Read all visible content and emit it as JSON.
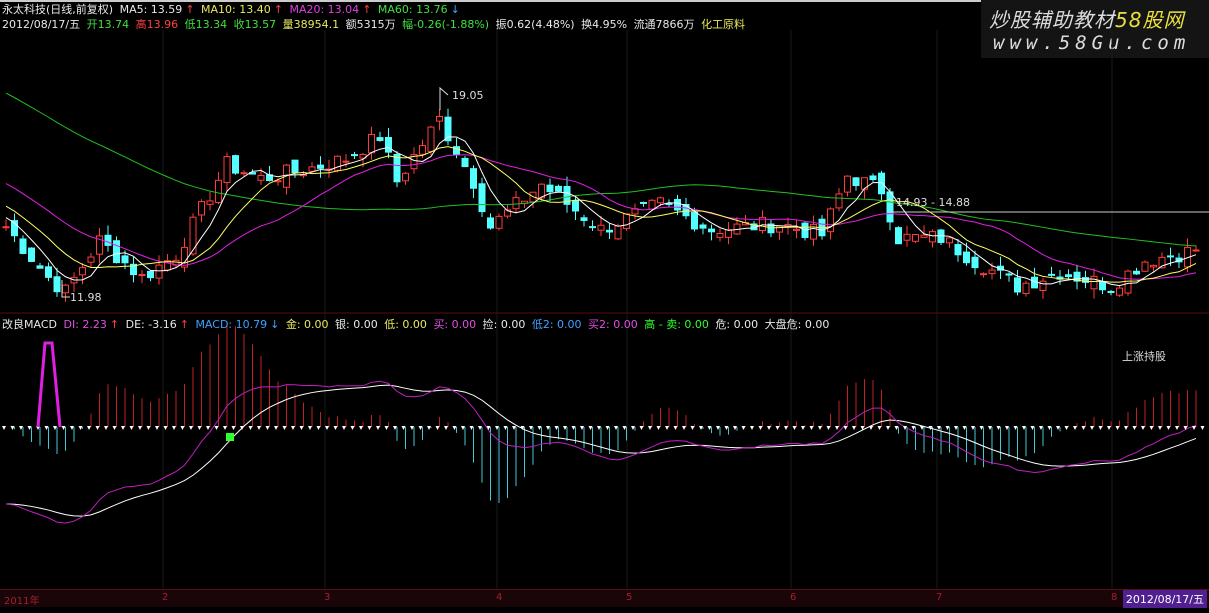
{
  "header": {
    "name": "永太科技(日线,前复权)",
    "ma5": "MA5: 13.59",
    "ma10": "MA10: 13.40",
    "ma20": "MA20: 13.04",
    "ma60": "MA60: 13.76",
    "date": "2012/08/17/五",
    "open": "开13.74",
    "high": "高13.96",
    "low": "低13.34",
    "close": "收13.57",
    "volume": "量38954.1",
    "amount": "额5315万",
    "change": "幅-0.26(-1.88%)",
    "amplitude": "振0.62(4.48%)",
    "turnover": "换4.95%",
    "float": "流通7866万",
    "sector": "化工原料"
  },
  "watermark": {
    "line1a": "炒股辅助教材",
    "line1b": "58股网",
    "line2": "www.58Gu.com"
  },
  "annotations": {
    "high_label": "19.05",
    "low_label": "11.98",
    "range_label": "14.93 - 14.88",
    "signal_label": "上涨持股"
  },
  "macd_header": {
    "title": "改良MACD",
    "di": "DI: 2.23",
    "de": "DE: -3.16",
    "macd": "MACD: 10.79",
    "jin": "金: 0.00",
    "yin": "银: 0.00",
    "di_low": "低: 0.00",
    "mai": "买: 0.00",
    "jian": "捡: 0.00",
    "di2": "低2: 0.00",
    "mai2": "买2: 0.00",
    "gao_mai": "高 - 卖: 0.00",
    "wei": "危: 0.00",
    "dapan": "大盘危: 0.00"
  },
  "axis": {
    "ticks": [
      "2011年",
      "2",
      "3",
      "4",
      "5",
      "6",
      "7",
      "8"
    ],
    "current_date": "2012/08/17/五"
  },
  "colors": {
    "up": "#ff3c3c",
    "down": "#54ffff",
    "ma5": "#ffffff",
    "ma10": "#ffff60",
    "ma20": "#e020e0",
    "ma60": "#20c020"
  },
  "chart_data": {
    "type": "candlestick",
    "title": "永太科技(日线,前复权)",
    "price_range": [
      11.98,
      19.05
    ],
    "close_path": [
      [
        0,
        14.4
      ],
      [
        5,
        12.6
      ],
      [
        7,
        12.1
      ],
      [
        11,
        13.9
      ],
      [
        16,
        12.6
      ],
      [
        20,
        13.4
      ],
      [
        26,
        16.6
      ],
      [
        30,
        16.1
      ],
      [
        35,
        16.4
      ],
      [
        40,
        16.8
      ],
      [
        44,
        17.6
      ],
      [
        46,
        16.0
      ],
      [
        51,
        18.2
      ],
      [
        55,
        16.0
      ],
      [
        57,
        14.4
      ],
      [
        63,
        15.9
      ],
      [
        70,
        14.3
      ],
      [
        77,
        15.2
      ],
      [
        83,
        14.3
      ],
      [
        91,
        14.5
      ],
      [
        96,
        14.1
      ],
      [
        99,
        16.2
      ],
      [
        103,
        15.7
      ],
      [
        105,
        14.0
      ],
      [
        110,
        14.0
      ],
      [
        114,
        13.2
      ],
      [
        119,
        12.3
      ],
      [
        124,
        12.8
      ],
      [
        130,
        12.3
      ],
      [
        134,
        13.2
      ],
      [
        140,
        13.57
      ]
    ],
    "series": [
      "MA5",
      "MA10",
      "MA20",
      "MA60"
    ],
    "sub_chart": "改良MACD (DIF, DEA, MACD bars)"
  }
}
